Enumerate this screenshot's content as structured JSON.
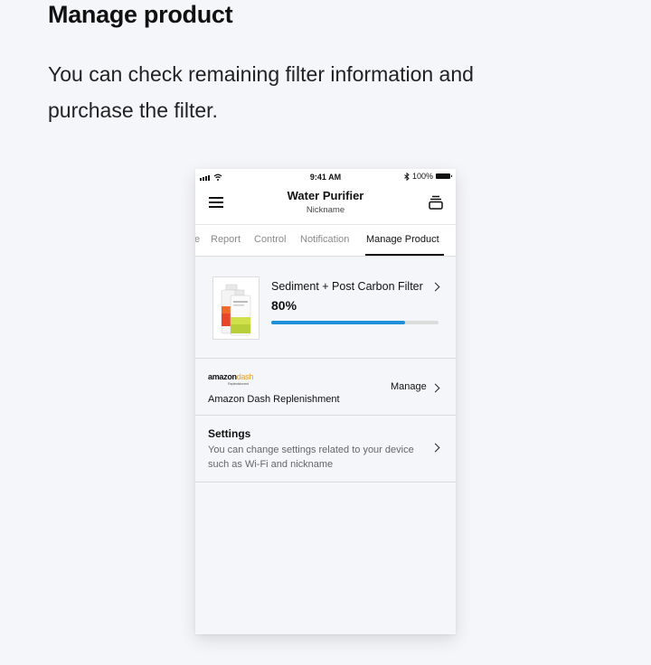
{
  "page": {
    "heading": "Manage product",
    "description": "You can check remaining filter information and purchase the filter."
  },
  "status_bar": {
    "time": "9:41 AM",
    "battery": "100%"
  },
  "app_bar": {
    "title": "Water Purifier",
    "subtitle": "Nickname",
    "menu_icon": "hamburger-menu-icon",
    "product_icon": "stack-icon"
  },
  "tabs": [
    {
      "label": "e",
      "active": false
    },
    {
      "label": "Report",
      "active": false
    },
    {
      "label": "Control",
      "active": false
    },
    {
      "label": "Notification",
      "active": false
    },
    {
      "label": "Manage Product",
      "active": true
    }
  ],
  "filter": {
    "name": "Sediment + Post Carbon Filter",
    "percent_label": "80%",
    "percent": 80,
    "accent_color": "#1e8fd9"
  },
  "amazon_dash": {
    "logo_word": "amazon",
    "logo_dash": "dash",
    "logo_sub": "Replenishment",
    "name": "Amazon Dash Replenishment",
    "action": "Manage"
  },
  "settings": {
    "title": "Settings",
    "description": "You can change settings related to your device such as Wi-Fi and nickname"
  }
}
